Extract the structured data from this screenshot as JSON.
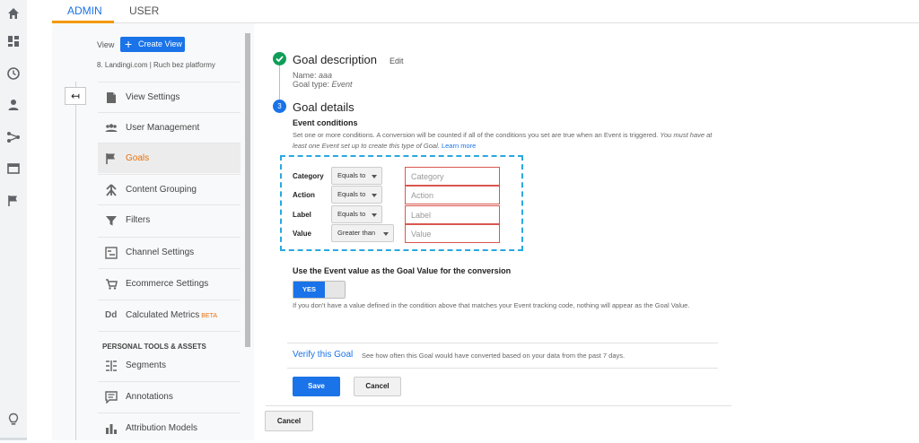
{
  "rail": {
    "icons": [
      "home-icon",
      "dashboard-icon",
      "clock-icon",
      "person-icon",
      "flow-icon",
      "display-icon",
      "flag-icon",
      "lightbulb-icon"
    ]
  },
  "tabs": {
    "admin": "ADMIN",
    "user": "USER"
  },
  "nav": {
    "view_label": "View",
    "create_view": "Create View",
    "account": "8. Landingi.com | Ruch bez platformy",
    "items": [
      {
        "label": "View Settings",
        "icon": "document-icon"
      },
      {
        "label": "User Management",
        "icon": "users-icon"
      },
      {
        "label": "Goals",
        "icon": "flag-icon"
      },
      {
        "label": "Content Grouping",
        "icon": "grouping-icon"
      },
      {
        "label": "Filters",
        "icon": "filter-icon"
      },
      {
        "label": "Channel Settings",
        "icon": "channel-icon"
      },
      {
        "label": "Ecommerce Settings",
        "icon": "cart-icon"
      },
      {
        "label": "Calculated Metrics",
        "icon": "dd-icon",
        "badge": "BETA"
      }
    ],
    "section_header": "PERSONAL TOOLS & ASSETS",
    "tools": [
      {
        "label": "Segments",
        "icon": "segments-icon"
      },
      {
        "label": "Annotations",
        "icon": "annotation-icon"
      },
      {
        "label": "Attribution Models",
        "icon": "bar-chart-icon"
      }
    ]
  },
  "goal_description": {
    "title": "Goal description",
    "edit": "Edit",
    "name_label": "Name:",
    "name_value": "aaa",
    "type_label": "Goal type:",
    "type_value": "Event"
  },
  "goal_details": {
    "step_number": "3",
    "title": "Goal details",
    "conditions_title": "Event conditions",
    "desc_main": "Set one or more conditions. A conversion will be counted if all of the conditions you set are true when an Event is triggered.",
    "desc_italic": "You must have at least one Event set up to create this type of Goal.",
    "learn_more": "Learn more",
    "conditions": [
      {
        "label": "Category",
        "operator": "Equals to",
        "placeholder": "Category"
      },
      {
        "label": "Action",
        "operator": "Equals to",
        "placeholder": "Action"
      },
      {
        "label": "Label",
        "operator": "Equals to",
        "placeholder": "Label"
      },
      {
        "label": "Value",
        "operator": "Greater than",
        "placeholder": "Value"
      }
    ],
    "event_value_title": "Use the Event value as the Goal Value for the conversion",
    "toggle_label": "YES",
    "event_value_desc": "If you don't have a value defined in the condition above that matches your Event tracking code, nothing will appear as the Goal Value.",
    "verify_link": "Verify this Goal",
    "verify_desc": "See how often this Goal would have converted based on your data from the past 7 days.",
    "save": "Save",
    "cancel": "Cancel"
  },
  "bottom_cancel": "Cancel",
  "colors": {
    "accent_blue": "#1a73e8",
    "active_orange": "#e8710a",
    "success_green": "#0f9d58",
    "error_red": "#d9574f",
    "highlight_box": "#2aa8e0"
  }
}
